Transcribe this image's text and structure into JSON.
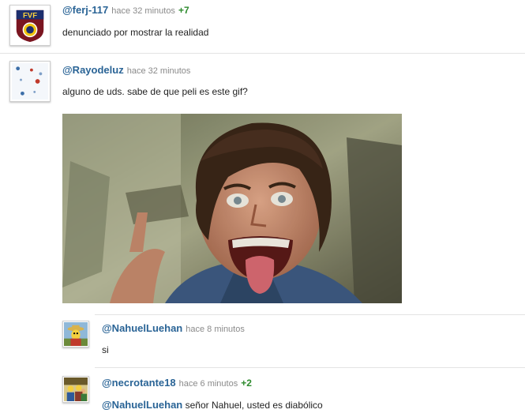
{
  "comments": [
    {
      "user": "@ferj-117",
      "time": "hace 32 minutos",
      "votes": "+7",
      "text": "denunciado por mostrar la realidad",
      "avatar_icon": "fvf-crest-avatar"
    },
    {
      "user": "@Rayodeluz",
      "time": "hace 32 minutos",
      "text": "alguno de uds. sabe de que peli es este gif?",
      "avatar_icon": "speckled-avatar",
      "attachment": "gif-image-screaming-man"
    },
    {
      "user": "@NahuelLuehan",
      "time": "hace 8 minutos",
      "text": "si",
      "avatar_icon": "cartoon-character-avatar"
    },
    {
      "user": "@necrotante18",
      "time": "hace 6 minutos",
      "votes": "+2",
      "mention": "@NahuelLuehan",
      "text": "señor Nahuel, usted es diabólico",
      "avatar_icon": "cartoon-group-avatar"
    }
  ],
  "colors": {
    "username": "#2a6496",
    "positive_votes": "#2e8b2e",
    "timestamp": "#8a8a8a"
  }
}
